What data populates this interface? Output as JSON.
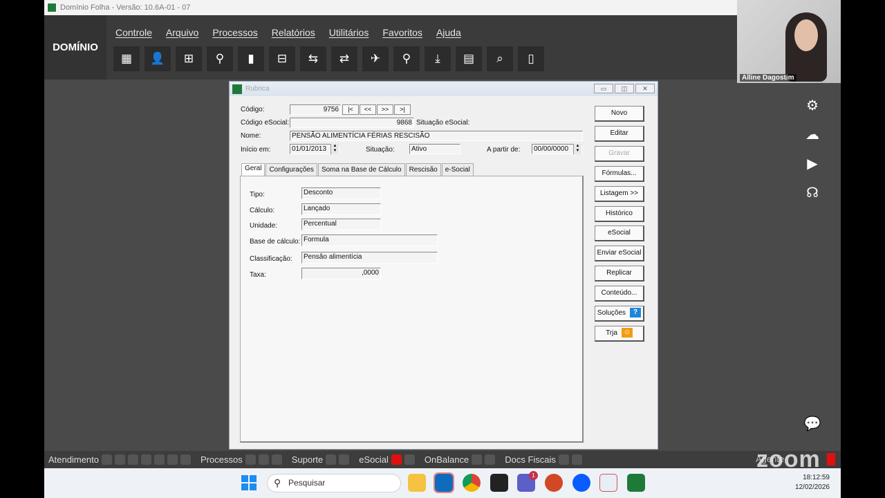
{
  "app": {
    "title": "Domínio Folha - Versão: 10.6A-01 - 07",
    "brand": "DOMÍNIO",
    "menu": [
      "Controle",
      "Arquivo",
      "Processos",
      "Relatórios",
      "Utilitários",
      "Favoritos",
      "Ajuda"
    ],
    "toolbar_icons": [
      "building-icon",
      "user-icon",
      "list-add-icon",
      "user-search-icon",
      "document-icon",
      "calculator-form-icon",
      "transfer-icon",
      "exchange-document-icon",
      "airplane-icon",
      "search-icon",
      "download-icon",
      "calculator-icon",
      "chart-search-icon",
      "door-exit-icon"
    ]
  },
  "webcam": {
    "name": "Alline Dagostim"
  },
  "dialog": {
    "title": "Rubrica",
    "labels": {
      "codigo": "Código:",
      "codigo_esocial": "Código eSocial:",
      "situacao_esocial": "Situação eSocial:",
      "nome": "Nome:",
      "inicio_em": "Início em:",
      "situacao": "Situação:",
      "a_partir_de": "A partir de:"
    },
    "values": {
      "codigo": "9756",
      "codigo_esocial": "9868",
      "nome": "PENSÃO ALIMENTÍCIA FÉRIAS RESCISÃO",
      "inicio_em": "01/01/2013",
      "situacao": "Ativo",
      "a_partir_de": "00/00/0000"
    },
    "nav_buttons": [
      "|<",
      "<<",
      ">>",
      ">|"
    ],
    "tabs": [
      "Geral",
      "Configurações",
      "Soma na Base de Cálculo",
      "Rescisão",
      "e-Social"
    ],
    "active_tab": "Geral",
    "geral": {
      "tipo_label": "Tipo:",
      "tipo": "Desconto",
      "calculo_label": "Cálculo:",
      "calculo": "Lançado",
      "unidade_label": "Unidade:",
      "unidade": "Percentual",
      "base_label": "Base de cálculo:",
      "base": "Formula",
      "classificacao_label": "Classificação:",
      "classificacao": "Pensão alimentícia",
      "taxa_label": "Taxa:",
      "taxa": ",0000"
    },
    "side_buttons": [
      "Novo",
      "Editar",
      "Gravar",
      "Fórmulas...",
      "Listagem >>",
      "Histórico",
      "eSocial",
      "Enviar eSocial",
      "Replicar",
      "Conteúdo...",
      "Soluções",
      "Trja"
    ]
  },
  "statusbar": {
    "items": [
      "Atendimento",
      "Processos",
      "Suporte",
      "eSocial",
      "OnBalance",
      "Docs Fiscais"
    ],
    "agente": "Agente",
    "zoom_logo": "zoom"
  },
  "taskbar": {
    "search_placeholder": "Pesquisar",
    "time": "18:12:59",
    "date": "12/02/2026",
    "teams_badge": "1"
  }
}
